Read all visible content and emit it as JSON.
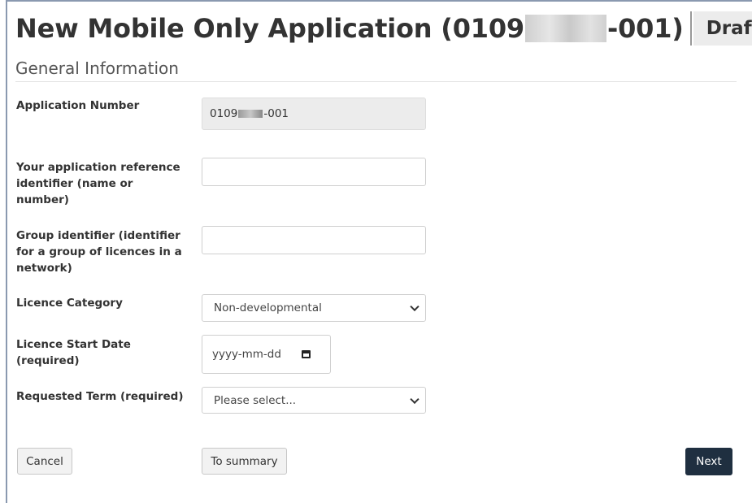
{
  "header": {
    "title_prefix": "New Mobile Only Application (0109",
    "title_suffix": "-001)",
    "status": "Draft"
  },
  "section": {
    "title": "General Information"
  },
  "fields": {
    "application_number": {
      "label": "Application Number",
      "value_prefix": "0109",
      "value_suffix": "-001"
    },
    "reference_identifier": {
      "label": "Your application reference identifier (name or number)",
      "value": ""
    },
    "group_identifier": {
      "label": "Group identifier (identifier for a group of licences in a network)",
      "value": ""
    },
    "licence_category": {
      "label": "Licence Category",
      "selected": "Non-developmental"
    },
    "licence_start_date": {
      "label": "Licence Start Date (required)",
      "placeholder": "yyyy-mm-dd"
    },
    "requested_term": {
      "label": "Requested Term (required)",
      "selected": "Please select..."
    }
  },
  "actions": {
    "cancel": "Cancel",
    "to_summary": "To summary",
    "next": "Next"
  },
  "icons": {
    "calendar": "calendar-icon",
    "dropdown": "chevron-down-icon"
  },
  "colors": {
    "primary_button": "#1f2f40",
    "badge_background": "#ececec",
    "readonly_background": "#ececec"
  }
}
